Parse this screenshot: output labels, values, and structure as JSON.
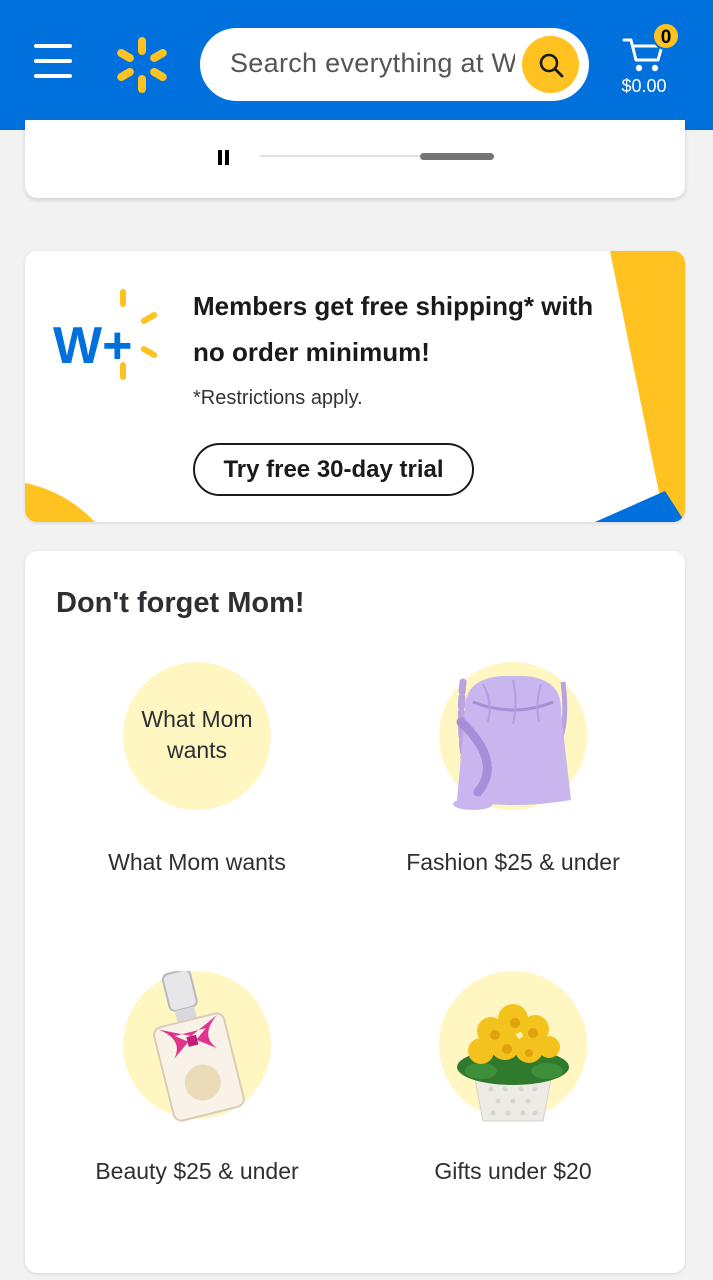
{
  "header": {
    "search_placeholder": "Search everything at W",
    "cart_count": "0",
    "cart_total": "$0.00",
    "colors": {
      "brand_blue": "#0071dc",
      "brand_yellow": "#ffc220"
    }
  },
  "carousel": {
    "pause_icon": "pause-icon"
  },
  "promo": {
    "logo_text": "W+",
    "headline": "Members get free shipping* with no order minimum!",
    "note": "*Restrictions apply.",
    "cta_label": "Try free 30-day trial"
  },
  "mom_section": {
    "title": "Don't forget Mom!",
    "tiles": [
      {
        "label": "What Mom wants",
        "circle_text": "What Mom wants",
        "icon": "what-mom-wants-graphic"
      },
      {
        "label": "Fashion $25 & under",
        "icon": "purple-handbag-image"
      },
      {
        "label": "Beauty $25 & under",
        "icon": "perfume-bottle-image"
      },
      {
        "label": "Gifts under $20",
        "icon": "yellow-flower-pot-image"
      }
    ]
  }
}
